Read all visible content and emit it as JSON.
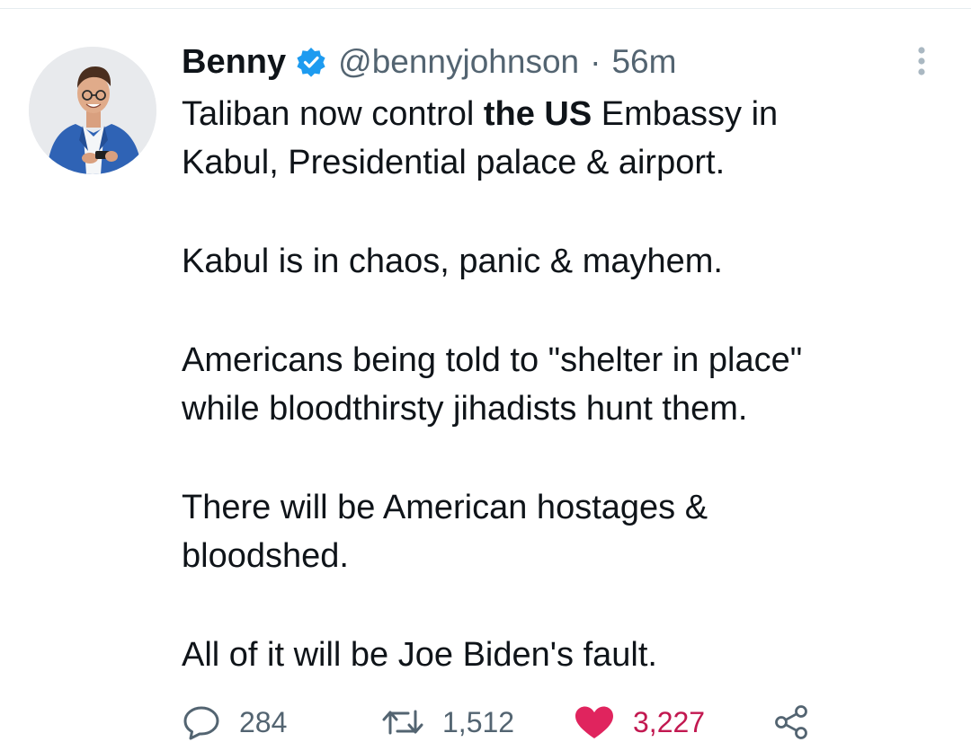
{
  "author": {
    "display_name": "Benny",
    "verified": true,
    "handle": "@bennyjohnson",
    "separator": "·",
    "time": "56m",
    "avatar_icon": "profile-photo"
  },
  "tweet": {
    "line1_pre": "Taliban now control ",
    "line1_bold": "the US",
    "line1_post": " Embassy in",
    "line2": "Kabul, Presidential palace & airport.",
    "para2": "Kabul is in chaos, panic & mayhem.",
    "para3_line1": "Americans being told to \"shelter in place\"",
    "para3_line2": "while bloodthirsty jihadists hunt them.",
    "para4_line1": "There will be American hostages &",
    "para4_line2": "bloodshed.",
    "para5": "All of it will be Joe Biden's fault."
  },
  "actions": {
    "reply_count": "284",
    "retweet_count": "1,512",
    "like_count": "3,227",
    "like_color": "#e0245e",
    "muted_color": "#536471",
    "verified_color": "#1d9bf0"
  }
}
